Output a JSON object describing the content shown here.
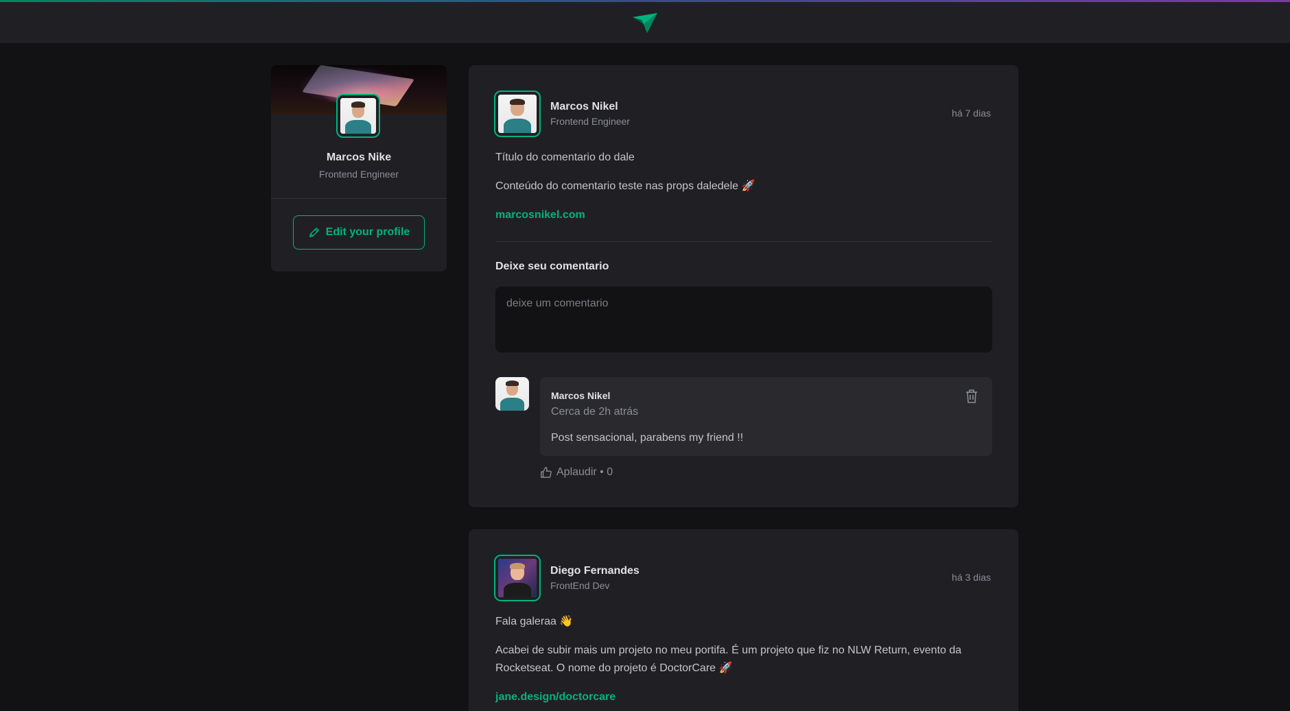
{
  "header": {
    "logo_icon": "paper-plane-icon"
  },
  "profile": {
    "name": "Marcos Nike",
    "role": "Frontend Engineer",
    "edit_label": "Edit your profile"
  },
  "posts": [
    {
      "author": "Marcos Nikel",
      "role": "Frontend Engineer",
      "time": "há 7 dias",
      "title_line": "Título do comentario do dale",
      "content_line": "Conteúdo do comentario teste nas props daledele 🚀",
      "link": "marcosnikel.com",
      "comment_form": {
        "title": "Deixe seu comentario",
        "placeholder": "deixe um comentario"
      },
      "comments": [
        {
          "author": "Marcos Nikel",
          "time": "Cerca de 2h atrás",
          "text": "Post sensacional, parabens my friend !!",
          "applaud": "Aplaudir • 0"
        }
      ]
    },
    {
      "author": "Diego Fernandes",
      "role": "FrontEnd Dev",
      "time": "há 3 dias",
      "greeting": "Fala galeraa 👋",
      "content_line": "Acabei de subir mais um projeto no meu portifa. É um projeto que fiz no NLW Return, evento da Rocketseat. O nome do projeto é DoctorCare 🚀",
      "link": "jane.design/doctorcare"
    }
  ],
  "colors": {
    "background": "#121214",
    "surface": "#202024",
    "accent": "#00b37e"
  }
}
